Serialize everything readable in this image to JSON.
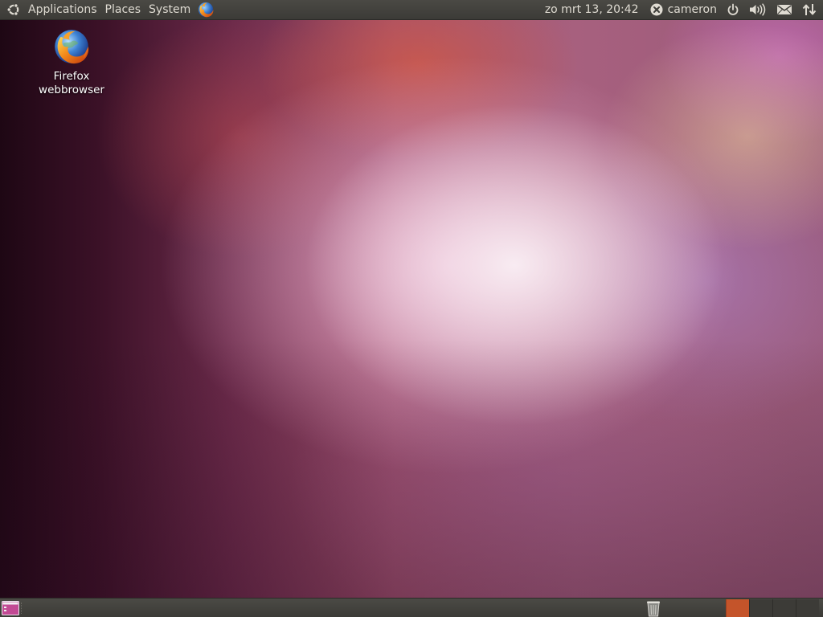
{
  "top_panel": {
    "menus": [
      "Applications",
      "Places",
      "System"
    ],
    "clock": "zo mrt 13, 20:42",
    "user_name": "cameron",
    "icons": {
      "logo": "ubuntu-logo-icon",
      "launcher": "firefox-icon",
      "status": "user-status-icon",
      "power": "power-icon",
      "volume": "volume-icon",
      "mail": "mail-icon",
      "network": "network-icon"
    }
  },
  "desktop": {
    "icons": [
      {
        "label": "Firefox\nwebbrowser",
        "icon": "firefox-icon"
      }
    ]
  },
  "bottom_panel": {
    "icons": {
      "show_desktop": "show-desktop-icon",
      "trash": "trash-icon"
    },
    "workspaces": 4,
    "active_workspace": 1
  },
  "colors": {
    "panel_bg": "#3c3b37",
    "panel_text": "#dfdbd2",
    "active_workspace": "#c4542a"
  }
}
